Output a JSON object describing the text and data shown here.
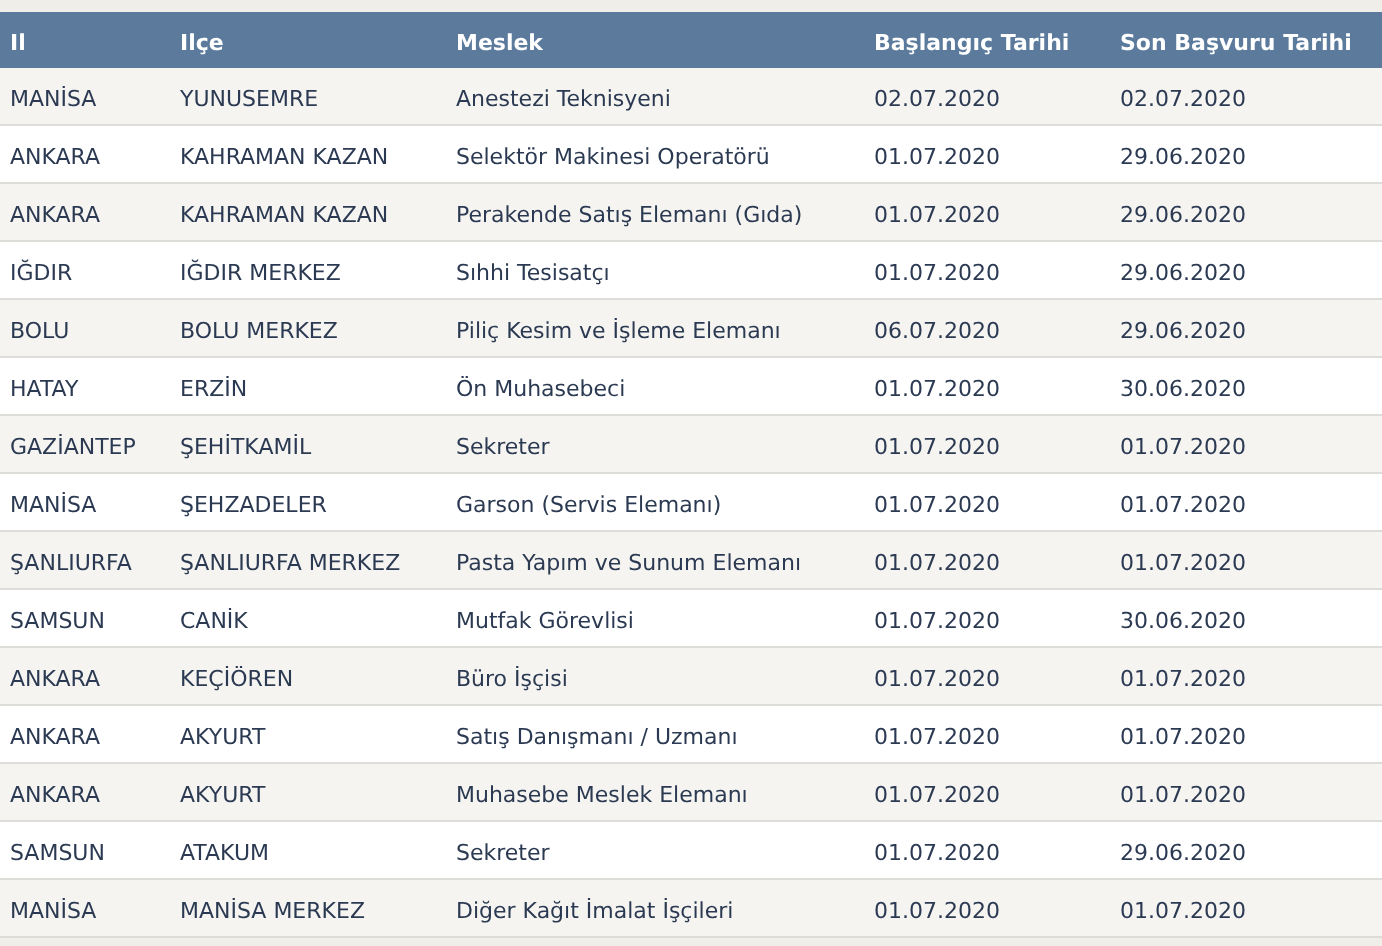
{
  "table": {
    "columns": [
      "Il",
      "Ilçe",
      "Meslek",
      "Başlangıç Tarihi",
      "Son Başvuru Tarihi"
    ],
    "rows": [
      [
        "MANİSA",
        "YUNUSEMRE",
        "Anestezi Teknisyeni",
        "02.07.2020",
        "02.07.2020"
      ],
      [
        "ANKARA",
        "KAHRAMAN KAZAN",
        "Selektör Makinesi Operatörü",
        "01.07.2020",
        "29.06.2020"
      ],
      [
        "ANKARA",
        "KAHRAMAN KAZAN",
        "Perakende Satış Elemanı (Gıda)",
        "01.07.2020",
        "29.06.2020"
      ],
      [
        "IĞDIR",
        "IĞDIR MERKEZ",
        "Sıhhi Tesisatçı",
        "01.07.2020",
        "29.06.2020"
      ],
      [
        "BOLU",
        "BOLU MERKEZ",
        "Piliç Kesim ve İşleme Elemanı",
        "06.07.2020",
        "29.06.2020"
      ],
      [
        "HATAY",
        "ERZİN",
        "Ön Muhasebeci",
        "01.07.2020",
        "30.06.2020"
      ],
      [
        "GAZİANTEP",
        "ŞEHİTKAMİL",
        "Sekreter",
        "01.07.2020",
        "01.07.2020"
      ],
      [
        "MANİSA",
        "ŞEHZADELER",
        "Garson (Servis Elemanı)",
        "01.07.2020",
        "01.07.2020"
      ],
      [
        "ŞANLIURFA",
        "ŞANLIURFA MERKEZ",
        "Pasta Yapım ve Sunum Elemanı",
        "01.07.2020",
        "01.07.2020"
      ],
      [
        "SAMSUN",
        "CANİK",
        "Mutfak Görevlisi",
        "01.07.2020",
        "30.06.2020"
      ],
      [
        "ANKARA",
        "KEÇİÖREN",
        "Büro İşçisi",
        "01.07.2020",
        "01.07.2020"
      ],
      [
        "ANKARA",
        "AKYURT",
        "Satış Danışmanı / Uzmanı",
        "01.07.2020",
        "01.07.2020"
      ],
      [
        "ANKARA",
        "AKYURT",
        "Muhasebe Meslek Elemanı",
        "01.07.2020",
        "01.07.2020"
      ],
      [
        "SAMSUN",
        "ATAKUM",
        "Sekreter",
        "01.07.2020",
        "29.06.2020"
      ],
      [
        "MANİSA",
        "MANİSA MERKEZ",
        "Diğer Kağıt İmalat İşçileri",
        "01.07.2020",
        "01.07.2020"
      ]
    ]
  }
}
